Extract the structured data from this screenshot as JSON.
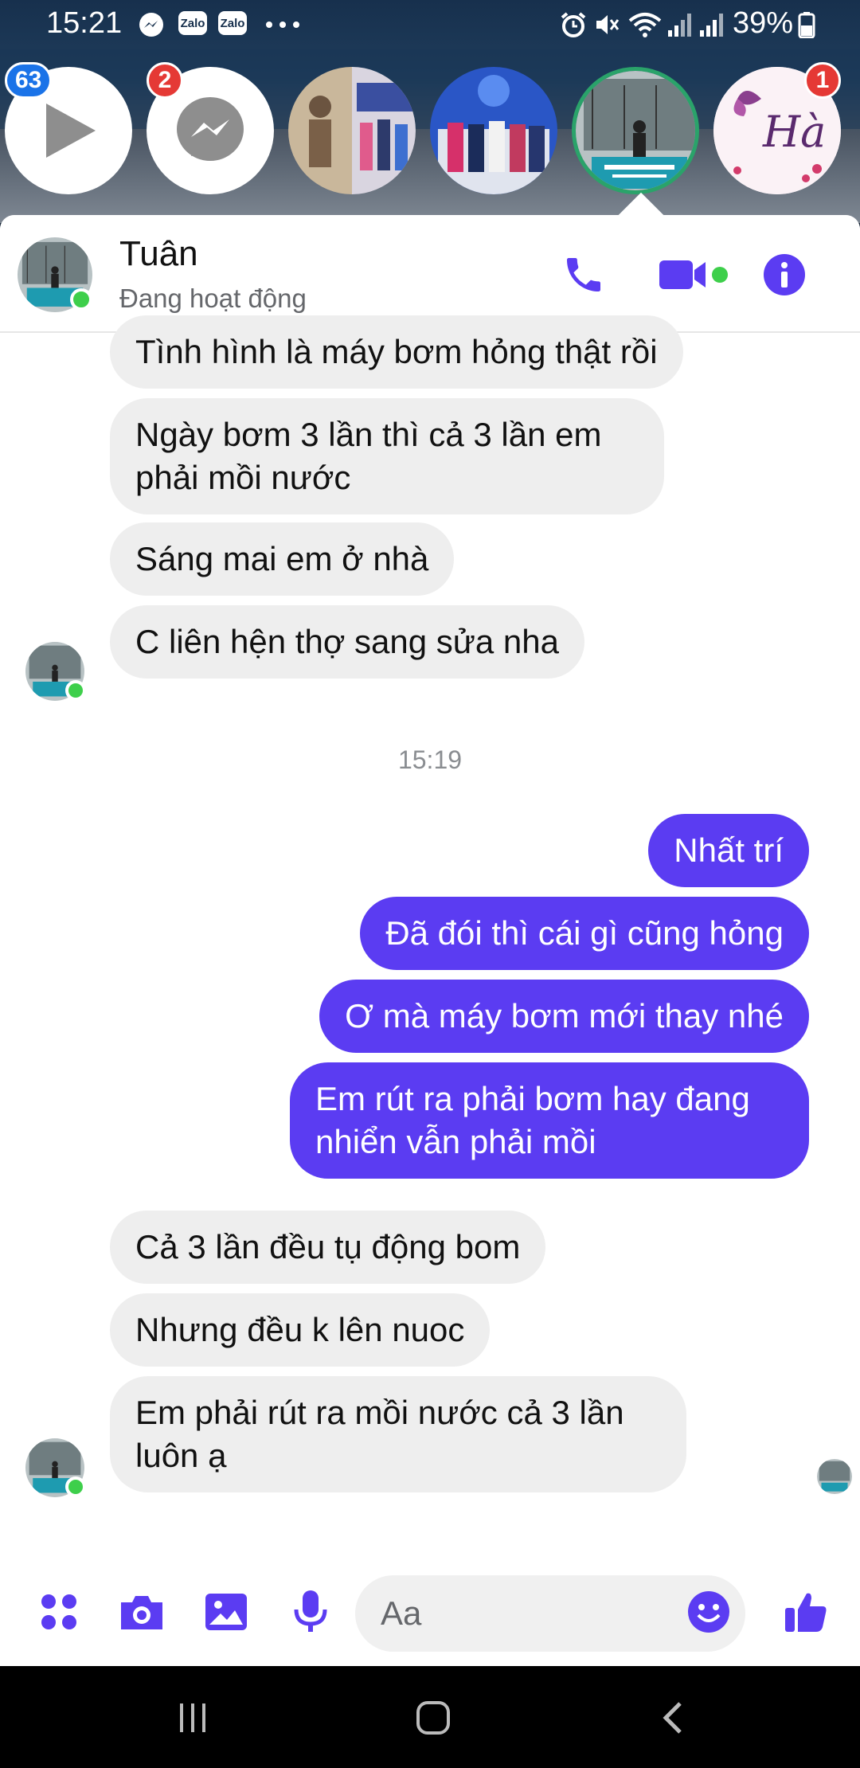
{
  "status_bar": {
    "time": "15:21",
    "battery_percent": "39%",
    "zalo_label": "Zalo"
  },
  "chat_heads": [
    {
      "name": "video-chat-head",
      "badge": "63",
      "badge_color": "#1a73e8"
    },
    {
      "name": "messenger-chat-head",
      "badge": "2",
      "badge_color": "#e53935"
    },
    {
      "name": "contact-chat-head-1",
      "badge": "",
      "badge_color": ""
    },
    {
      "name": "contact-chat-head-2",
      "badge": "",
      "badge_color": ""
    },
    {
      "name": "contact-chat-head-tuan",
      "badge": "",
      "badge_color": ""
    },
    {
      "name": "contact-chat-head-ha",
      "badge": "1",
      "badge_color": "#e53935"
    }
  ],
  "header": {
    "contact_name": "Tuân",
    "contact_status": "Đang hoạt động"
  },
  "messages": [
    {
      "side": "in",
      "text": "Tình hình là máy bơm hỏng thật rồi"
    },
    {
      "side": "in",
      "text": "Ngày bơm 3 lần thì cả 3 lần em phải mồi nước"
    },
    {
      "side": "in",
      "text": "Sáng mai em ở nhà"
    },
    {
      "side": "in",
      "text": "C liên hện thợ sang sửa nha"
    },
    {
      "side": "out",
      "text": "Nhất trí"
    },
    {
      "side": "out",
      "text": "Đã đói thì cái gì cũng hỏng"
    },
    {
      "side": "out",
      "text": "Ơ mà máy bơm mới thay nhé"
    },
    {
      "side": "out",
      "text": "Em rút ra phải bơm hay đang nhiển vẫn phải mồi"
    },
    {
      "side": "in",
      "text": "Cả 3 lần đều tụ động  bom"
    },
    {
      "side": "in",
      "text": "Nhưng đều k lên nuoc"
    },
    {
      "side": "in",
      "text": "Em phải rút ra mồi nước cả 3 lần luôn ạ"
    }
  ],
  "timestamp": "15:19",
  "composer": {
    "placeholder": "Aa"
  },
  "colors": {
    "accent": "#5b3cf2",
    "incoming_bubble": "#eeeeee",
    "online": "#3ecf4b"
  }
}
